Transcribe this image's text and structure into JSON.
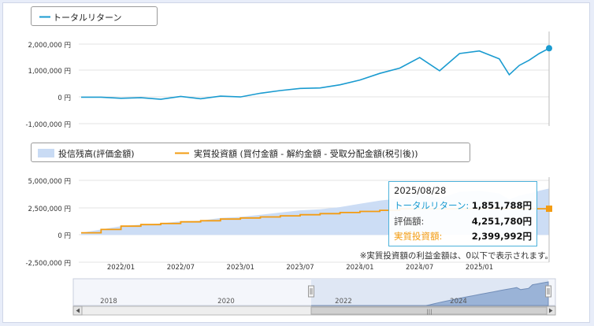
{
  "colors": {
    "total_return": "#1a9bd0",
    "balance_fill": "#c9dbf4",
    "invested": "#f39c12",
    "grid": "#e3e3e3",
    "navigator": "#8faad3"
  },
  "top_legend": {
    "label": "トータルリターン"
  },
  "bottom_legend": {
    "balance_label": "投信残高(評価金額)",
    "invested_label": "実質投資額 (買付金額 - 解約金額 - 受取分配金額(税引後))"
  },
  "tooltip": {
    "date": "2025/08/28",
    "total_return_label": "トータルリターン:",
    "total_return_value": "1,851,788円",
    "valuation_label": "評価額:",
    "valuation_value": "4,251,780円",
    "invested_label": "実質投資額:",
    "invested_value": "2,399,992円"
  },
  "note": "※実質投資額の利益金額は、0以下で表示されます。",
  "navigator": {
    "year_labels": [
      "2018",
      "2020",
      "2022",
      "2024"
    ],
    "scroll_left_icon": "chevron-left-icon",
    "scroll_right_icon": "chevron-right-icon",
    "grip_icon": "grip-icon"
  },
  "chart_data": [
    {
      "type": "line",
      "series": [
        {
          "name": "トータルリターン",
          "x": [
            "2021/09",
            "2021/11",
            "2022/01",
            "2022/03",
            "2022/05",
            "2022/07",
            "2022/09",
            "2022/11",
            "2023/01",
            "2023/03",
            "2023/05",
            "2023/07",
            "2023/09",
            "2023/11",
            "2024/01",
            "2024/03",
            "2024/05",
            "2024/07",
            "2024/09",
            "2024/11",
            "2025/01",
            "2025/03",
            "2025/04",
            "2025/05",
            "2025/06",
            "2025/07",
            "2025/08"
          ],
          "values": [
            0,
            0,
            -40000,
            -20000,
            -80000,
            30000,
            -60000,
            40000,
            10000,
            150000,
            250000,
            330000,
            350000,
            470000,
            650000,
            900000,
            1100000,
            1500000,
            1000000,
            1650000,
            1750000,
            1450000,
            850000,
            1200000,
            1400000,
            1650000,
            1851788
          ]
        }
      ],
      "ylim": [
        -1000000,
        2500000
      ],
      "yticks": [
        "2,000,000 円",
        "1,000,000 円",
        "0 円",
        "-1,000,000 円"
      ],
      "grid": true,
      "legend": "top-left"
    },
    {
      "type": "area",
      "x": [
        "2021/09",
        "2021/11",
        "2022/01",
        "2022/03",
        "2022/05",
        "2022/07",
        "2022/09",
        "2022/11",
        "2023/01",
        "2023/03",
        "2023/05",
        "2023/07",
        "2023/09",
        "2023/11",
        "2024/01",
        "2024/03",
        "2024/05",
        "2024/07",
        "2024/09",
        "2024/11",
        "2025/01",
        "2025/03",
        "2025/04",
        "2025/05",
        "2025/06",
        "2025/07",
        "2025/08"
      ],
      "series": [
        {
          "name": "投信残高(評価金額)",
          "values": [
            200000,
            500000,
            800000,
            950000,
            1050000,
            1250000,
            1300000,
            1550000,
            1650000,
            1850000,
            2050000,
            2250000,
            2350000,
            2550000,
            2850000,
            3150000,
            3350000,
            3750000,
            3350000,
            3950000,
            4050000,
            3800000,
            3250000,
            3600000,
            3800000,
            4050000,
            4251780
          ]
        },
        {
          "name": "実質投資額 (買付金額 - 解約金額 - 受取分配金額(税引後))",
          "values": [
            200000,
            500000,
            800000,
            950000,
            1050000,
            1200000,
            1300000,
            1450000,
            1550000,
            1650000,
            1750000,
            1850000,
            1950000,
            2050000,
            2150000,
            2250000,
            2399992,
            2399992,
            2399992,
            2399992,
            2399992,
            2399992,
            2399992,
            2399992,
            2399992,
            2399992,
            2399992
          ]
        }
      ],
      "ylim": [
        -2500000,
        5000000
      ],
      "yticks": [
        "5,000,000 円",
        "2,500,000 円",
        "0 円",
        "-2,500,000 円"
      ],
      "xticks": [
        "2022/01",
        "2022/07",
        "2023/01",
        "2023/07",
        "2024/01",
        "2024/07",
        "2025/01"
      ],
      "grid": true,
      "legend": "top-left"
    }
  ]
}
